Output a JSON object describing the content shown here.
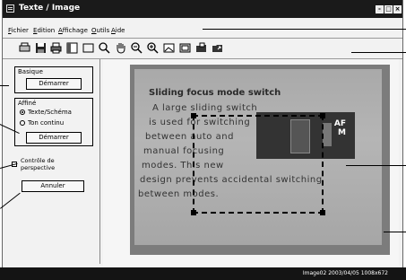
{
  "window": {
    "title": "Texte / Image",
    "controls": [
      "-",
      "□",
      "×"
    ]
  },
  "menu": {
    "items": [
      {
        "label": "Fichier",
        "u": "F",
        "rest": "ichier"
      },
      {
        "label": "Edition",
        "u": "E",
        "rest": "dition"
      },
      {
        "label": "Affichage",
        "u": "A",
        "rest": "ffichage"
      },
      {
        "label": "Outils",
        "u": "O",
        "rest": "utils"
      },
      {
        "label": "Aide",
        "u": "A",
        "rest": "ide"
      }
    ]
  },
  "toolbar": {
    "icons": [
      "scan-icon",
      "save-icon",
      "print-icon",
      "view-icon",
      "rectangle-select-icon",
      "zoom-icon",
      "hand-icon",
      "zoom-out-icon",
      "zoom-in-icon",
      "image-icon",
      "fit-window-icon",
      "open-folder-icon",
      "export-icon"
    ]
  },
  "panel": {
    "basic": {
      "label": "Basique",
      "button": "Démarrer"
    },
    "refined": {
      "label": "Affiné",
      "option1": "Texte/Schéma",
      "option2": "Ton continu",
      "selected": "Texte/Schéma",
      "button": "Démarrer"
    },
    "perspective": {
      "label_line1": "Contrôle de",
      "label_line2": "perspective",
      "checked": false
    },
    "cancel": "Annuler"
  },
  "document": {
    "title": "Sliding focus mode switch",
    "lines": [
      "A large sliding switch",
      "is used for switching",
      "between auto and",
      "manual focusing",
      "modes. This new",
      "design prevents accidental switching",
      "between modes."
    ],
    "camera_labels": [
      "AF",
      "M"
    ]
  },
  "status": {
    "text": "Image02 2003/04/05 1008x672"
  }
}
